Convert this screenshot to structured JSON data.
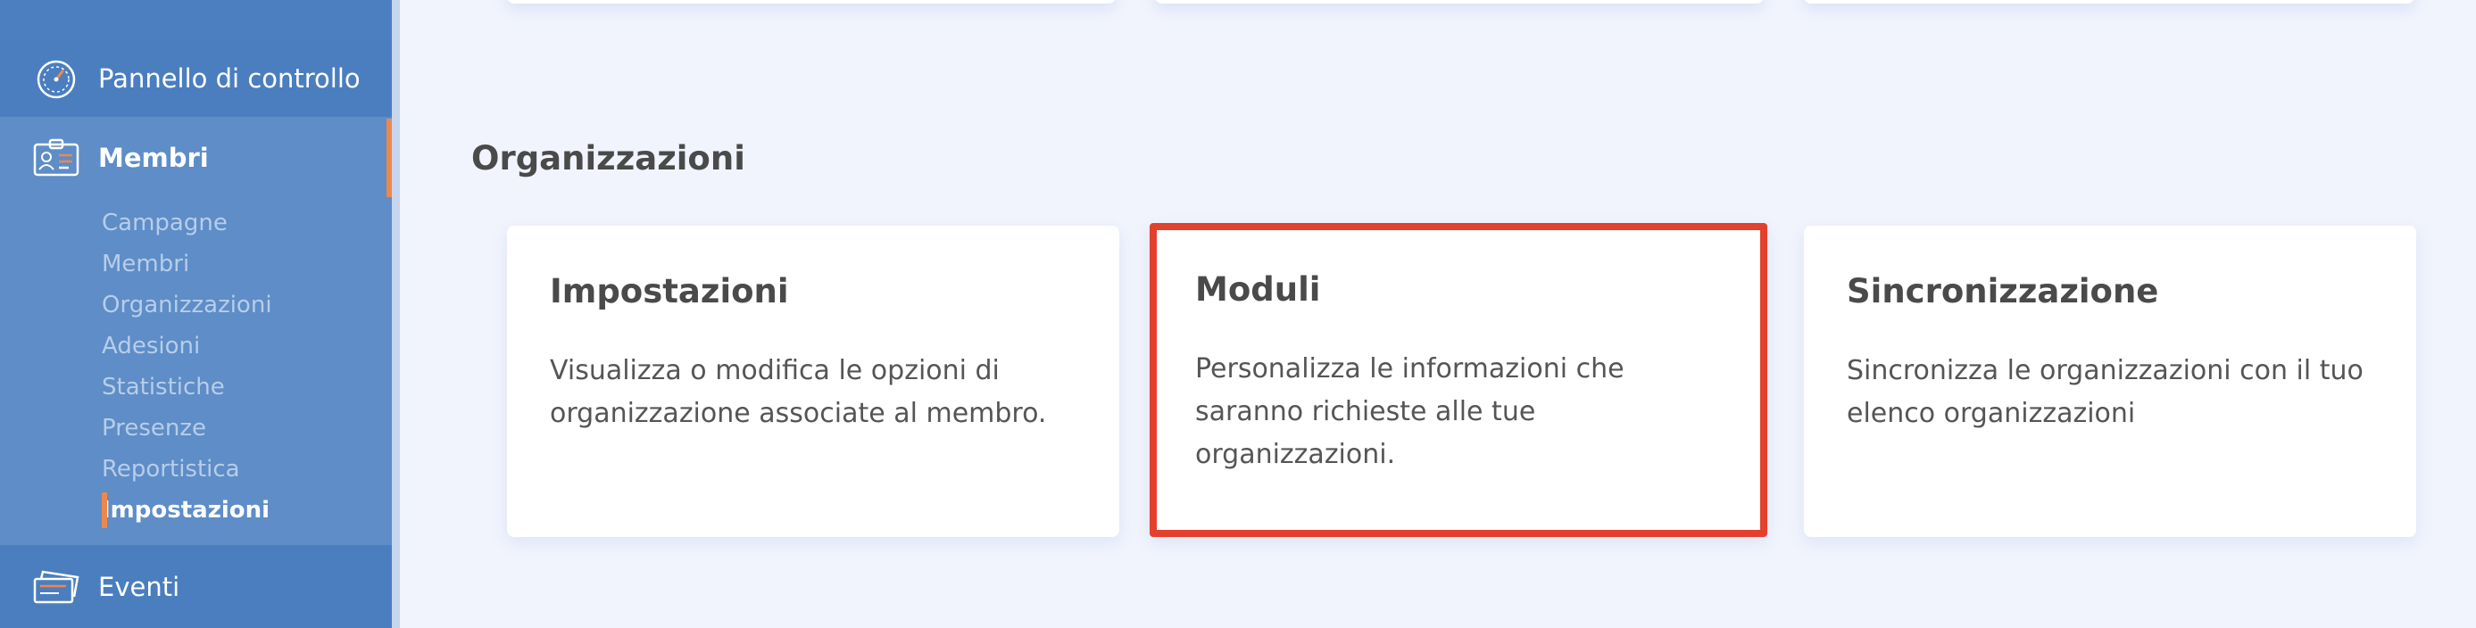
{
  "sidebar": {
    "dashboard_label": "Pannello di controllo",
    "members_label": "Membri",
    "events_label": "Eventi",
    "subitems": [
      {
        "label": "Campagne"
      },
      {
        "label": "Membri"
      },
      {
        "label": "Organizzazioni"
      },
      {
        "label": "Adesioni"
      },
      {
        "label": "Statistiche"
      },
      {
        "label": "Presenze"
      },
      {
        "label": "Reportistica"
      },
      {
        "label": "Impostazioni"
      }
    ],
    "active_subitem": "Impostazioni",
    "icons": {
      "dashboard": "speedometer-icon",
      "members": "id-badge-icon",
      "events": "tickets-icon"
    }
  },
  "main": {
    "section_title": "Organizzazioni",
    "cards": [
      {
        "title": "Impostazioni",
        "description": "Visualizza o modifica le opzioni di organizzazione associate al membro."
      },
      {
        "title": "Moduli",
        "description": "Personalizza le informazioni che saranno richieste alle tue organizzazioni."
      },
      {
        "title": "Sincronizzazione",
        "description": "Sincronizza le organizzazioni con il tuo elenco organizzazioni"
      }
    ]
  },
  "colors": {
    "sidebar": "#4b7fc0",
    "sidebar_section": "#5e8dc7",
    "accent": "#f0874a",
    "highlight": "#e4402e",
    "background": "#f1f4fd"
  }
}
